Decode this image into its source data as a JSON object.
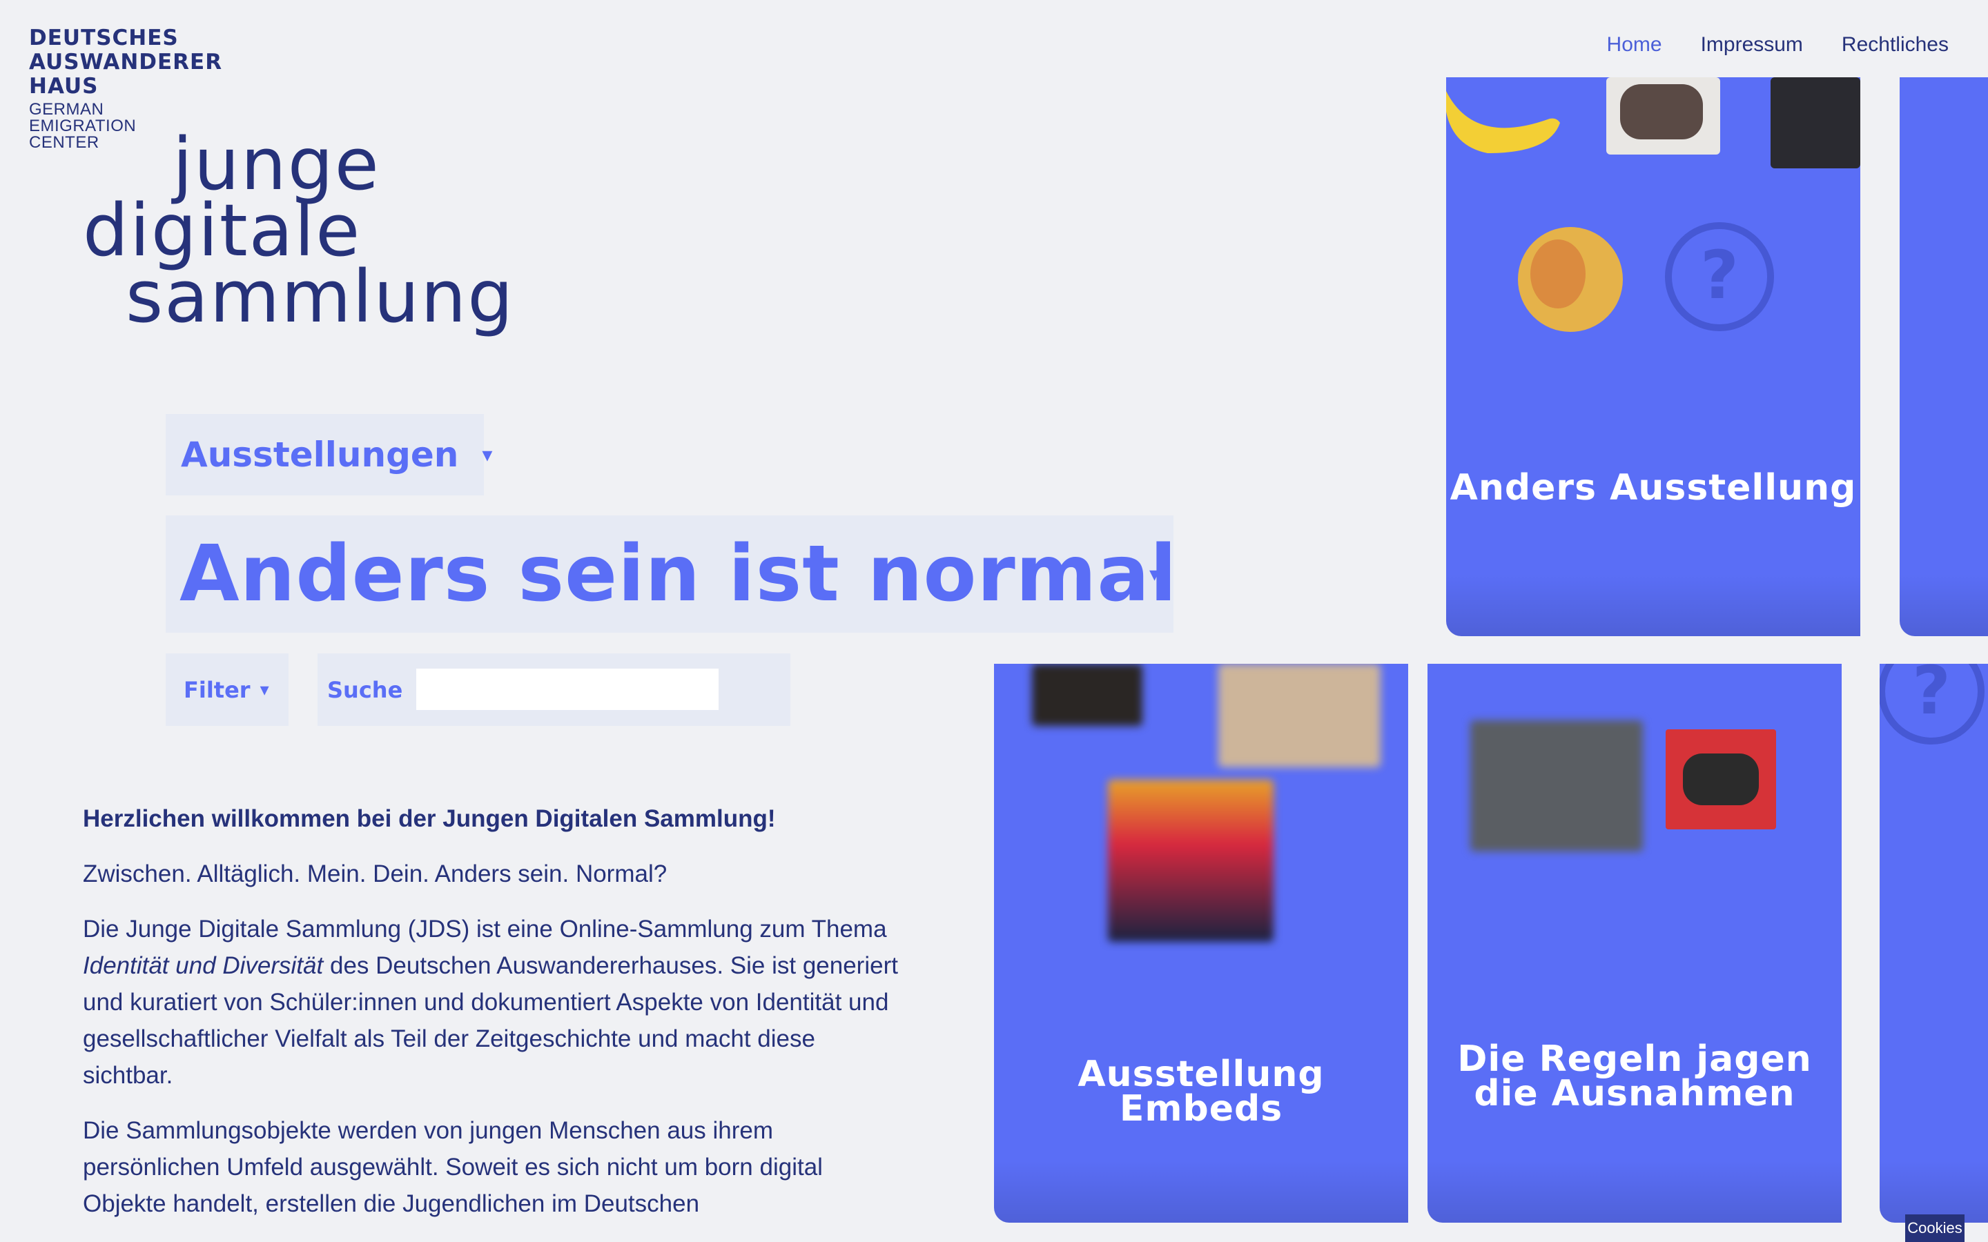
{
  "header": {
    "logo_lines_strong": [
      "DEUTSCHES",
      "AUSWANDERER",
      "HAUS"
    ],
    "logo_lines_light": [
      "GERMAN",
      "EMIGRATION",
      "CENTER"
    ]
  },
  "nav": {
    "items": [
      {
        "label": "Home",
        "active": true
      },
      {
        "label": "Impressum",
        "active": false
      },
      {
        "label": "Rechtliches",
        "active": false
      }
    ]
  },
  "brand": {
    "lines": [
      "junge",
      "digitale",
      "sammlung"
    ]
  },
  "controls": {
    "category_select": {
      "value": "Ausstellungen",
      "caret": "▾"
    },
    "exhibition_select": {
      "value": "Anders sein ist normal",
      "caret": "▾"
    },
    "filter": {
      "label": "Filter",
      "caret": "▾"
    },
    "search": {
      "label": "Suche",
      "value": ""
    }
  },
  "intro": {
    "heading": "Herzlichen willkommen bei der Jungen Digitalen Sammlung!",
    "line2": "Zwischen. Alltäglich. Mein. Dein. Anders sein. Normal?",
    "p3_pre": "Die Junge Digitale Sammlung (JDS) ist eine Online-Sammlung zum Thema ",
    "p3_em": "Identität und Diversität",
    "p3_post": " des Deutschen Auswandererhauses. Sie ist generiert und kuratiert von Schüler:innen und dokumentiert Aspekte von Identität und gesellschaftlicher Vielfalt als Teil der Zeitgeschichte und macht diese sichtbar.",
    "p4": "Die Sammlungsobjekte werden von jungen Menschen aus ihrem persönlichen Umfeld ausgewählt. Soweit es sich nicht um born digital Objekte handelt, erstellen die Jugendlichen im Deutschen"
  },
  "cards": [
    {
      "title": "Anders Ausstellung"
    },
    {
      "title": "Ausstellung Embeds"
    },
    {
      "title": "Die Regeln jagen die Ausnahmen"
    }
  ],
  "cookies": {
    "label": "Cookies"
  },
  "colors": {
    "accent": "#5a6ef6",
    "navy": "#26327a",
    "background": "#f0f1f4",
    "control_bg": "#e6eaf4"
  }
}
